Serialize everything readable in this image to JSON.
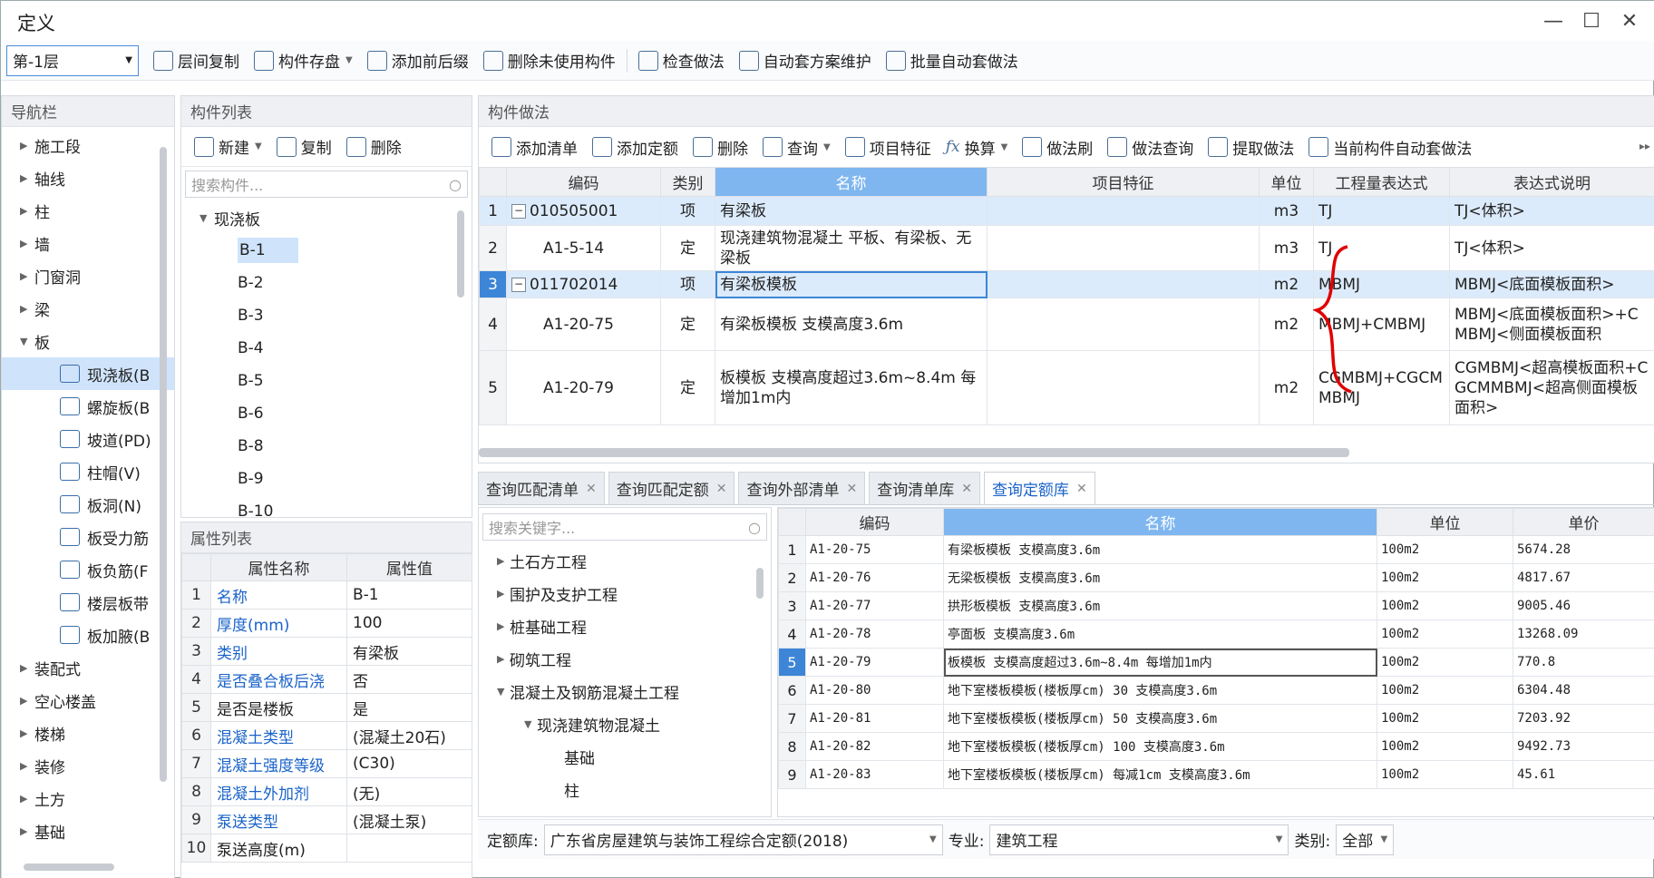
{
  "window": {
    "title": "定义"
  },
  "toolbar": {
    "floor": "第-1层",
    "buttons": [
      "层间复制",
      "构件存盘",
      "添加前后缀",
      "删除未使用构件",
      "检查做法",
      "自动套方案维护",
      "批量自动套做法"
    ]
  },
  "nav": {
    "title": "导航栏",
    "items": [
      "施工段",
      "轴线",
      "柱",
      "墙",
      "门窗洞",
      "梁",
      "板"
    ],
    "sub": [
      "现浇板(B",
      "螺旋板(B",
      "坡道(PD)",
      "柱帽(V)",
      "板洞(N)",
      "板受力筋",
      "板负筋(F",
      "楼层板带",
      "板加腋(B"
    ],
    "after": [
      "装配式",
      "空心楼盖",
      "楼梯",
      "装修",
      "土方",
      "基础"
    ]
  },
  "complist": {
    "title": "构件列表",
    "new": "新建",
    "copy": "复制",
    "delete": "删除",
    "search_placeholder": "搜索构件...",
    "group": "现浇板",
    "items": [
      "B-1",
      "B-2",
      "B-3",
      "B-4",
      "B-5",
      "B-6",
      "B-8",
      "B-9",
      "B-10"
    ]
  },
  "props": {
    "title": "属性列表",
    "col_name": "属性名称",
    "col_value": "属性值",
    "rows": [
      {
        "n": "1",
        "name": "名称",
        "value": "B-1"
      },
      {
        "n": "2",
        "name": "厚度(mm)",
        "value": "100"
      },
      {
        "n": "3",
        "name": "类别",
        "value": "有梁板"
      },
      {
        "n": "4",
        "name": "是否叠合板后浇",
        "value": "否"
      },
      {
        "n": "5",
        "name": "是否是楼板",
        "value": "是"
      },
      {
        "n": "6",
        "name": "混凝土类型",
        "value": "(混凝土20石)"
      },
      {
        "n": "7",
        "name": "混凝土强度等级",
        "value": "(C30)"
      },
      {
        "n": "8",
        "name": "混凝土外加剂",
        "value": "(无)"
      },
      {
        "n": "9",
        "name": "泵送类型",
        "value": "(混凝土泵)"
      },
      {
        "n": "10",
        "name": "泵送高度(m)",
        "value": ""
      }
    ]
  },
  "method": {
    "title": "构件做法",
    "tools": [
      "添加清单",
      "添加定额",
      "删除",
      "查询",
      "项目特征",
      "换算",
      "做法刷",
      "做法查询",
      "提取做法",
      "当前构件自动套做法"
    ],
    "headers": [
      "编码",
      "类别",
      "名称",
      "项目特征",
      "单位",
      "工程量表达式",
      "表达式说明"
    ],
    "rows": [
      {
        "n": "1",
        "code": "010505001",
        "type": "项",
        "name": "有梁板",
        "feature": "",
        "unit": "m3",
        "expr": "TJ",
        "desc": "TJ<体积>"
      },
      {
        "n": "2",
        "code": "A1-5-14",
        "type": "定",
        "name": "现浇建筑物混凝土 平板、有梁板、无梁板",
        "feature": "",
        "unit": "m3",
        "expr": "TJ",
        "desc": "TJ<体积>"
      },
      {
        "n": "3",
        "code": "011702014",
        "type": "项",
        "name": "有梁板模板",
        "feature": "",
        "unit": "m2",
        "expr": "MBMJ",
        "desc": "MBMJ<底面模板面积>"
      },
      {
        "n": "4",
        "code": "A1-20-75",
        "type": "定",
        "name": "有梁板模板 支模高度3.6m",
        "feature": "",
        "unit": "m2",
        "expr": "MBMJ+CMBMJ",
        "desc": "MBMJ<底面模板面积>+CMBMJ<侧面模板面积"
      },
      {
        "n": "5",
        "code": "A1-20-79",
        "type": "定",
        "name": "板模板 支模高度超过3.6m~8.4m 每增加1m内",
        "feature": "",
        "unit": "m2",
        "expr": "CGMBMJ+CGCMMBMJ",
        "desc": "CGMBMJ<超高模板面积+CGCMMBMJ<超高侧面模板面积>"
      }
    ]
  },
  "tabs": [
    "查询匹配清单",
    "查询匹配定额",
    "查询外部清单",
    "查询清单库",
    "查询定额库"
  ],
  "quota": {
    "search_placeholder": "搜索关键字...",
    "tree": [
      "土石方工程",
      "围护及支护工程",
      "桩基础工程",
      "砌筑工程",
      "混凝土及钢筋混凝土工程",
      "现浇建筑物混凝土",
      "基础",
      "柱"
    ],
    "headers": [
      "编码",
      "名称",
      "单位",
      "单价"
    ],
    "rows": [
      {
        "n": "1",
        "code": "A1-20-75",
        "name": "有梁板模板 支模高度3.6m",
        "unit": "100m2",
        "price": "5674.28"
      },
      {
        "n": "2",
        "code": "A1-20-76",
        "name": "无梁板模板 支模高度3.6m",
        "unit": "100m2",
        "price": "4817.67"
      },
      {
        "n": "3",
        "code": "A1-20-77",
        "name": "拱形板模板 支模高度3.6m",
        "unit": "100m2",
        "price": "9005.46"
      },
      {
        "n": "4",
        "code": "A1-20-78",
        "name": "亭面板 支模高度3.6m",
        "unit": "100m2",
        "price": "13268.09"
      },
      {
        "n": "5",
        "code": "A1-20-79",
        "name": "板模板 支模高度超过3.6m~8.4m 每增加1m内",
        "unit": "100m2",
        "price": "770.8"
      },
      {
        "n": "6",
        "code": "A1-20-80",
        "name": "地下室楼板模板(楼板厚cm) 30 支模高度3.6m",
        "unit": "100m2",
        "price": "6304.48"
      },
      {
        "n": "7",
        "code": "A1-20-81",
        "name": "地下室楼板模板(楼板厚cm) 50 支模高度3.6m",
        "unit": "100m2",
        "price": "7203.92"
      },
      {
        "n": "8",
        "code": "A1-20-82",
        "name": "地下室楼板模板(楼板厚cm) 100 支模高度3.6m",
        "unit": "100m2",
        "price": "9492.73"
      },
      {
        "n": "9",
        "code": "A1-20-83",
        "name": "地下室楼板模板(楼板厚cm) 每减1cm 支模高度3.6m",
        "unit": "100m2",
        "price": "45.61"
      }
    ],
    "lib_label": "定额库:",
    "lib_value": "广东省房屋建筑与装饰工程综合定额(2018)",
    "major_label": "专业:",
    "major_value": "建筑工程",
    "cat_label": "类别:",
    "cat_value": "全部"
  },
  "colors": {
    "accent": "#3d85d6",
    "header_highlight": "#7fb6ef",
    "annotation": "#e00000"
  }
}
